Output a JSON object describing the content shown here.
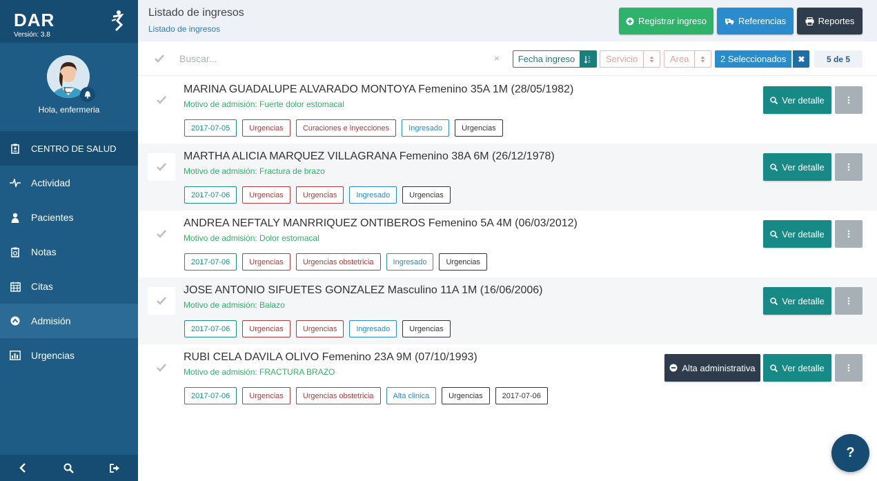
{
  "colors": {
    "sidebar": "#1e5c85",
    "sidebar_dark": "#174c72",
    "green": "#2db36a",
    "blue": "#2b8ccd",
    "dark": "#2f3c4c",
    "teal": "#188a86",
    "red": "#b23a3a"
  },
  "brand": {
    "name": "DAR",
    "version": "Versión: 3.8",
    "logo_icon": "dar-logo-icon"
  },
  "profile": {
    "greeting": "Hola, enfermeria",
    "avatar_icon": "nurse-avatar",
    "bell_icon": "bell-icon"
  },
  "nav": {
    "items": [
      {
        "label": "CENTRO DE SALUD",
        "icon": "clipboard-icon"
      },
      {
        "label": "Actividad",
        "icon": "heartbeat-icon"
      },
      {
        "label": "Pacientes",
        "icon": "user-icon"
      },
      {
        "label": "Notas",
        "icon": "notes-icon"
      },
      {
        "label": "Citas",
        "icon": "calendar-icon"
      },
      {
        "label": "Admisión",
        "icon": "admission-icon"
      },
      {
        "label": "Urgencias",
        "icon": "chart-icon"
      }
    ],
    "footer_icons": [
      "chevron-left-icon",
      "search-icon",
      "logout-icon"
    ]
  },
  "header": {
    "title": "Listado de ingresos",
    "breadcrumb": "Listado de ingresos",
    "buttons": {
      "registrar": "Registrar ingreso",
      "referencias": "Referencias",
      "reportes": "Reportes"
    }
  },
  "filters": {
    "search_placeholder": "Buscar...",
    "clear": "×",
    "fecha_label": "Fecha ingreso",
    "servicio_label": "Servicio",
    "area_label": "Area",
    "selected_label": "2 Seleccionados",
    "selected_clear": "✖",
    "count": "5 de 5"
  },
  "rows": [
    {
      "name": "MARINA GUADALUPE ALVARADO MONTOYA Femenino 35A 1M (28/05/1982)",
      "motive": "Motivo de admisión: Fuerte dolor estomacal",
      "tags": [
        "2017-07-05",
        "Urgencias",
        "Curaciones e inyecciones",
        "Ingresado",
        "Urgencias"
      ],
      "detail_label": "Ver detalle"
    },
    {
      "name": "MARTHA ALICIA MARQUEZ VILLAGRANA Femenino 38A 6M (26/12/1978)",
      "motive": "Motivo de admisión: Fractura de brazo",
      "tags": [
        "2017-07-06",
        "Urgencias",
        "Urgencias",
        "Ingresado",
        "Urgencias"
      ],
      "detail_label": "Ver detalle"
    },
    {
      "name": "ANDREA NEFTALY MANRRIQUEZ ONTIBEROS Femenino 5A 4M (06/03/2012)",
      "motive": "Motivo de admisión: Dolor estomacal",
      "tags": [
        "2017-07-06",
        "Urgencias",
        "Urgencias obstetricia",
        "Ingresado",
        "Urgencias"
      ],
      "detail_label": "Ver detalle"
    },
    {
      "name": "JOSE ANTONIO SIFUETES GONZALEZ Masculino 11A 1M (16/06/2006)",
      "motive": "Motivo de admisión: Balazo",
      "tags": [
        "2017-07-06",
        "Urgencias",
        "Urgencias",
        "Ingresado",
        "Urgencias"
      ],
      "detail_label": "Ver detalle"
    },
    {
      "name": "RUBI CELA DAVILA OLIVO Femenino 23A 9M (07/10/1993)",
      "motive": "Motivo de admisión: FRACTURA BRAZO",
      "tags": [
        "2017-07-06",
        "Urgencias",
        "Urgencias obstetricia",
        "Alta clinica",
        "Urgencias",
        "2017-07-06"
      ],
      "detail_label": "Ver detalle",
      "alta_label": "Alta administrativa"
    }
  ],
  "help": "?"
}
